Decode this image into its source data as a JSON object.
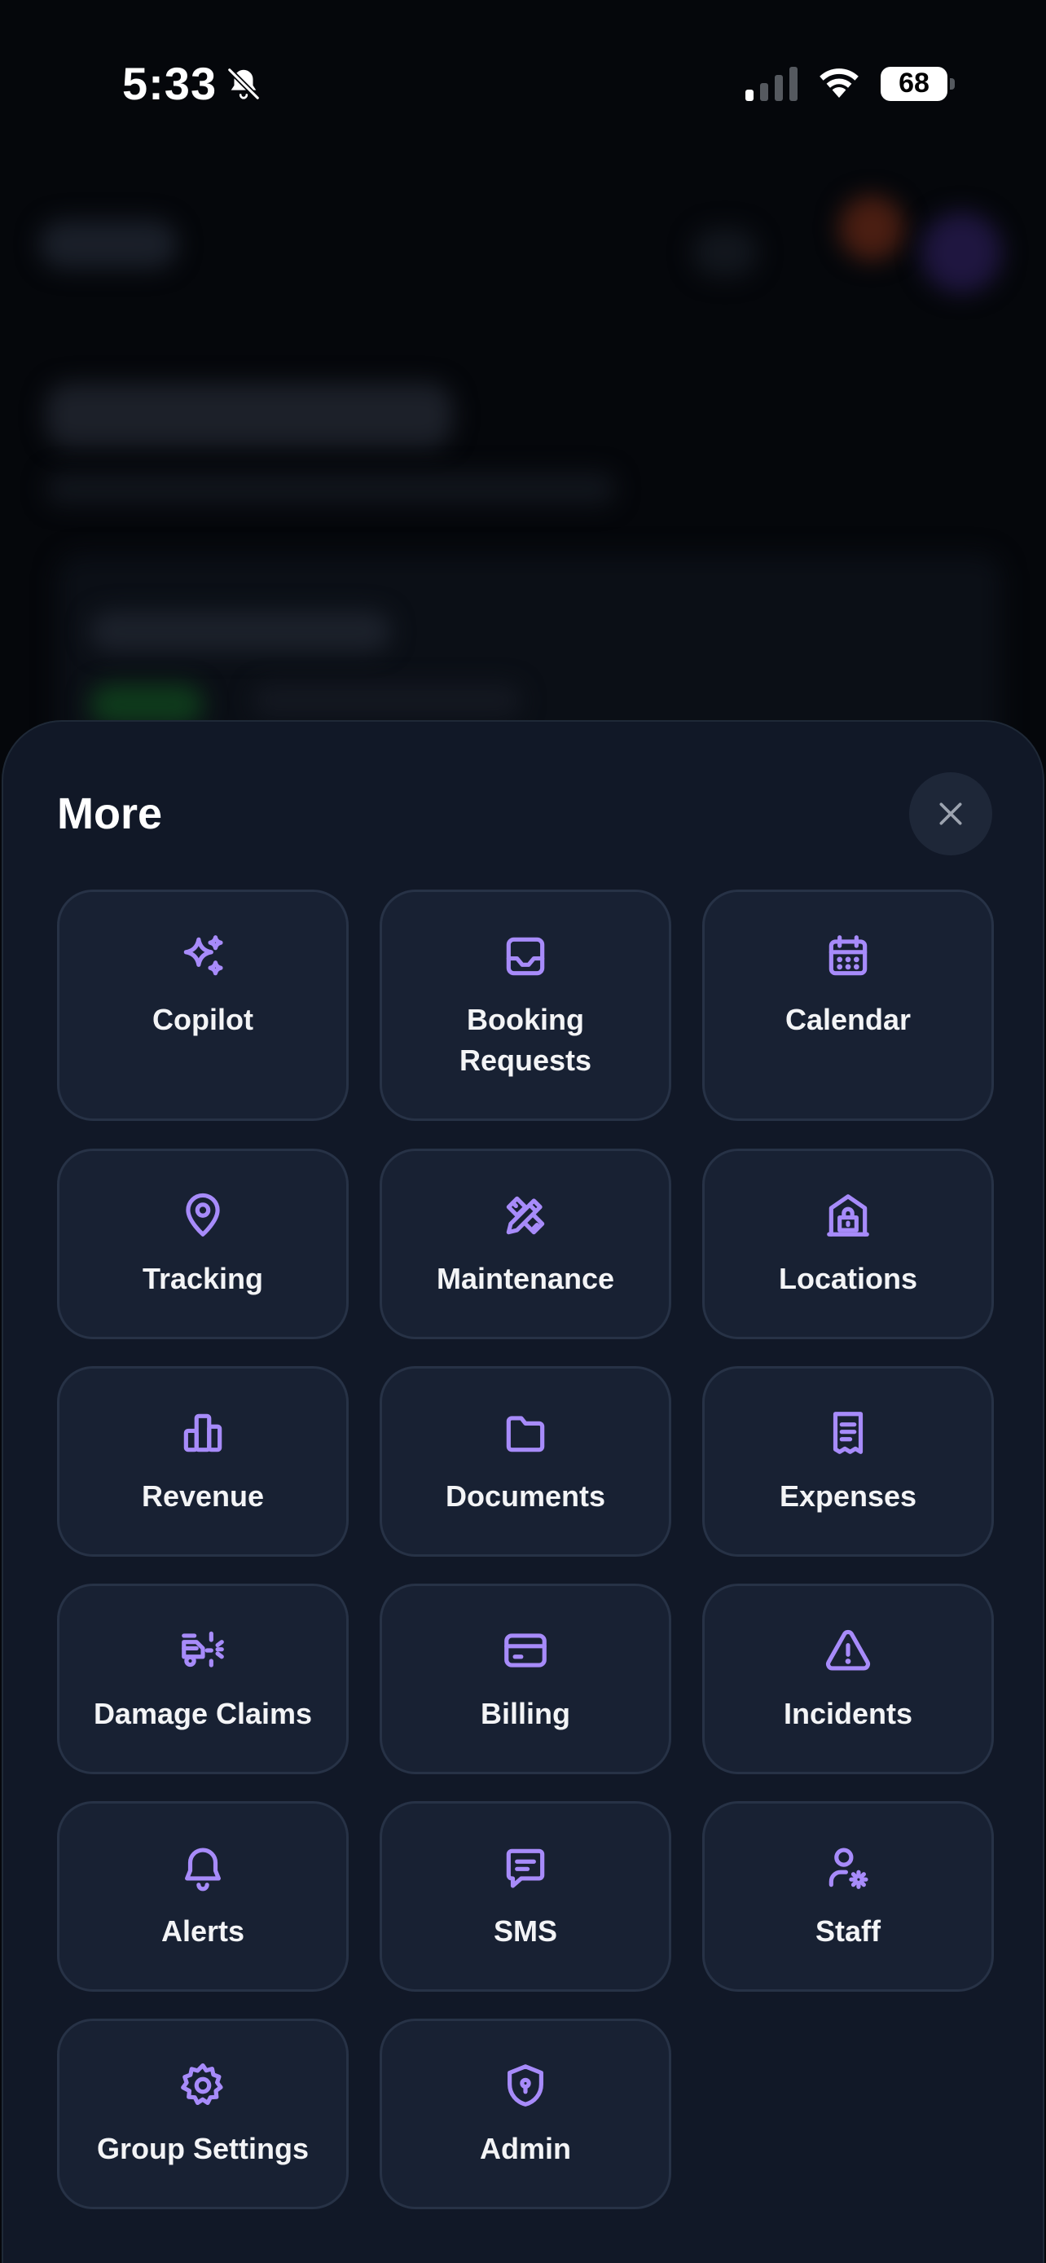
{
  "status_bar": {
    "time": "5:33",
    "battery": "68",
    "icons": {
      "mute": "bell-slash-icon",
      "signal": "cellular-signal-icon",
      "wifi": "wifi-icon",
      "battery": "battery-icon"
    }
  },
  "sheet": {
    "title": "More",
    "close_icon": "close-icon",
    "accent_color": "#a78bfa",
    "items": [
      {
        "label": "Copilot",
        "icon": "sparkles-icon"
      },
      {
        "label": "Booking Requests",
        "icon": "inbox-icon"
      },
      {
        "label": "Calendar",
        "icon": "calendar-icon"
      },
      {
        "label": "Tracking",
        "icon": "map-pin-icon"
      },
      {
        "label": "Maintenance",
        "icon": "tools-icon"
      },
      {
        "label": "Locations",
        "icon": "building-icon"
      },
      {
        "label": "Revenue",
        "icon": "bar-chart-icon"
      },
      {
        "label": "Documents",
        "icon": "folder-icon"
      },
      {
        "label": "Expenses",
        "icon": "receipt-icon"
      },
      {
        "label": "Damage Claims",
        "icon": "car-crash-icon"
      },
      {
        "label": "Billing",
        "icon": "credit-card-icon"
      },
      {
        "label": "Incidents",
        "icon": "warning-triangle-icon"
      },
      {
        "label": "Alerts",
        "icon": "bell-icon"
      },
      {
        "label": "SMS",
        "icon": "message-icon"
      },
      {
        "label": "Staff",
        "icon": "user-cog-icon"
      },
      {
        "label": "Group Settings",
        "icon": "gear-icon"
      },
      {
        "label": "Admin",
        "icon": "shield-lock-icon"
      }
    ]
  }
}
